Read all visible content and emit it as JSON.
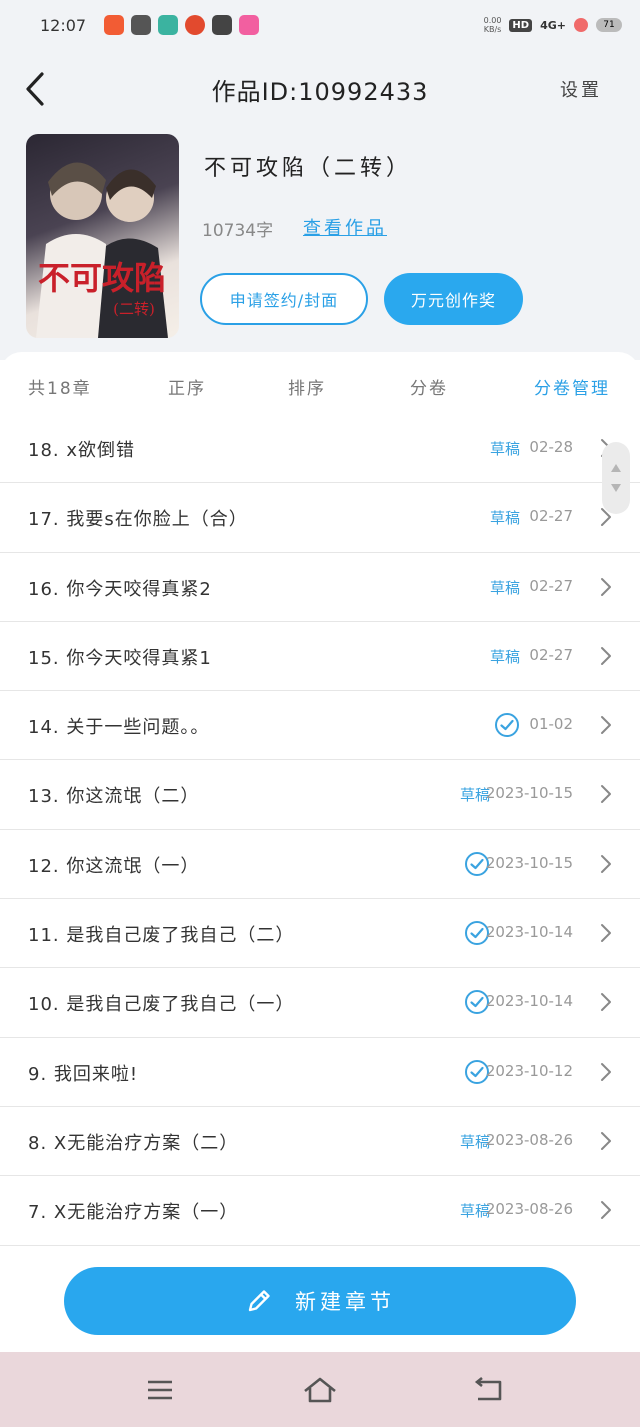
{
  "status_bar": {
    "time": "12:07",
    "net_speed_top": "0.00",
    "net_speed_bottom": "KB/s",
    "hd": "HD",
    "signal": "4G+",
    "battery": "71"
  },
  "nav": {
    "title": "作品ID:10992433",
    "settings_label": "设置"
  },
  "book": {
    "title": "不可攻陷（二转）",
    "word_count": "10734字",
    "view_link": "查看作品",
    "apply_button": "申请签约/封面",
    "fund_button": "万元创作奖"
  },
  "toolbar": {
    "count": "共18章",
    "order": "正序",
    "sort": "排序",
    "volume": "分卷",
    "volume_manage": "分卷管理"
  },
  "chapters": [
    {
      "title": "18. x欲倒错",
      "status": "草稿",
      "published": false,
      "date": "02-28"
    },
    {
      "title": "17. 我要s在你脸上（合）",
      "status": "草稿",
      "published": false,
      "date": "02-27"
    },
    {
      "title": "16. 你今天咬得真紧2",
      "status": "草稿",
      "published": false,
      "date": "02-27"
    },
    {
      "title": "15. 你今天咬得真紧1",
      "status": "草稿",
      "published": false,
      "date": "02-27"
    },
    {
      "title": "14. 关于一些问题。。",
      "status": "",
      "published": true,
      "date": "01-02"
    },
    {
      "title": "13. 你这流氓（二）",
      "status": "草稿",
      "published": false,
      "date": "2023-10-15"
    },
    {
      "title": "12. 你这流氓（一）",
      "status": "",
      "published": true,
      "date": "2023-10-15"
    },
    {
      "title": "11. 是我自己废了我自己（二）",
      "status": "",
      "published": true,
      "date": "2023-10-14"
    },
    {
      "title": "10. 是我自己废了我自己（一）",
      "status": "",
      "published": true,
      "date": "2023-10-14"
    },
    {
      "title": "9. 我回来啦!",
      "status": "",
      "published": true,
      "date": "2023-10-12"
    },
    {
      "title": "8. X无能治疗方案（二）",
      "status": "草稿",
      "published": false,
      "date": "2023-08-26"
    },
    {
      "title": "7. X无能治疗方案（一）",
      "status": "草稿",
      "published": false,
      "date": "2023-08-26"
    }
  ],
  "new_chapter_label": "新建章节",
  "colors": {
    "accent": "#2aa0e6",
    "header_bg": "#f1f3f6",
    "nav_bar_bg": "#ead7db"
  }
}
